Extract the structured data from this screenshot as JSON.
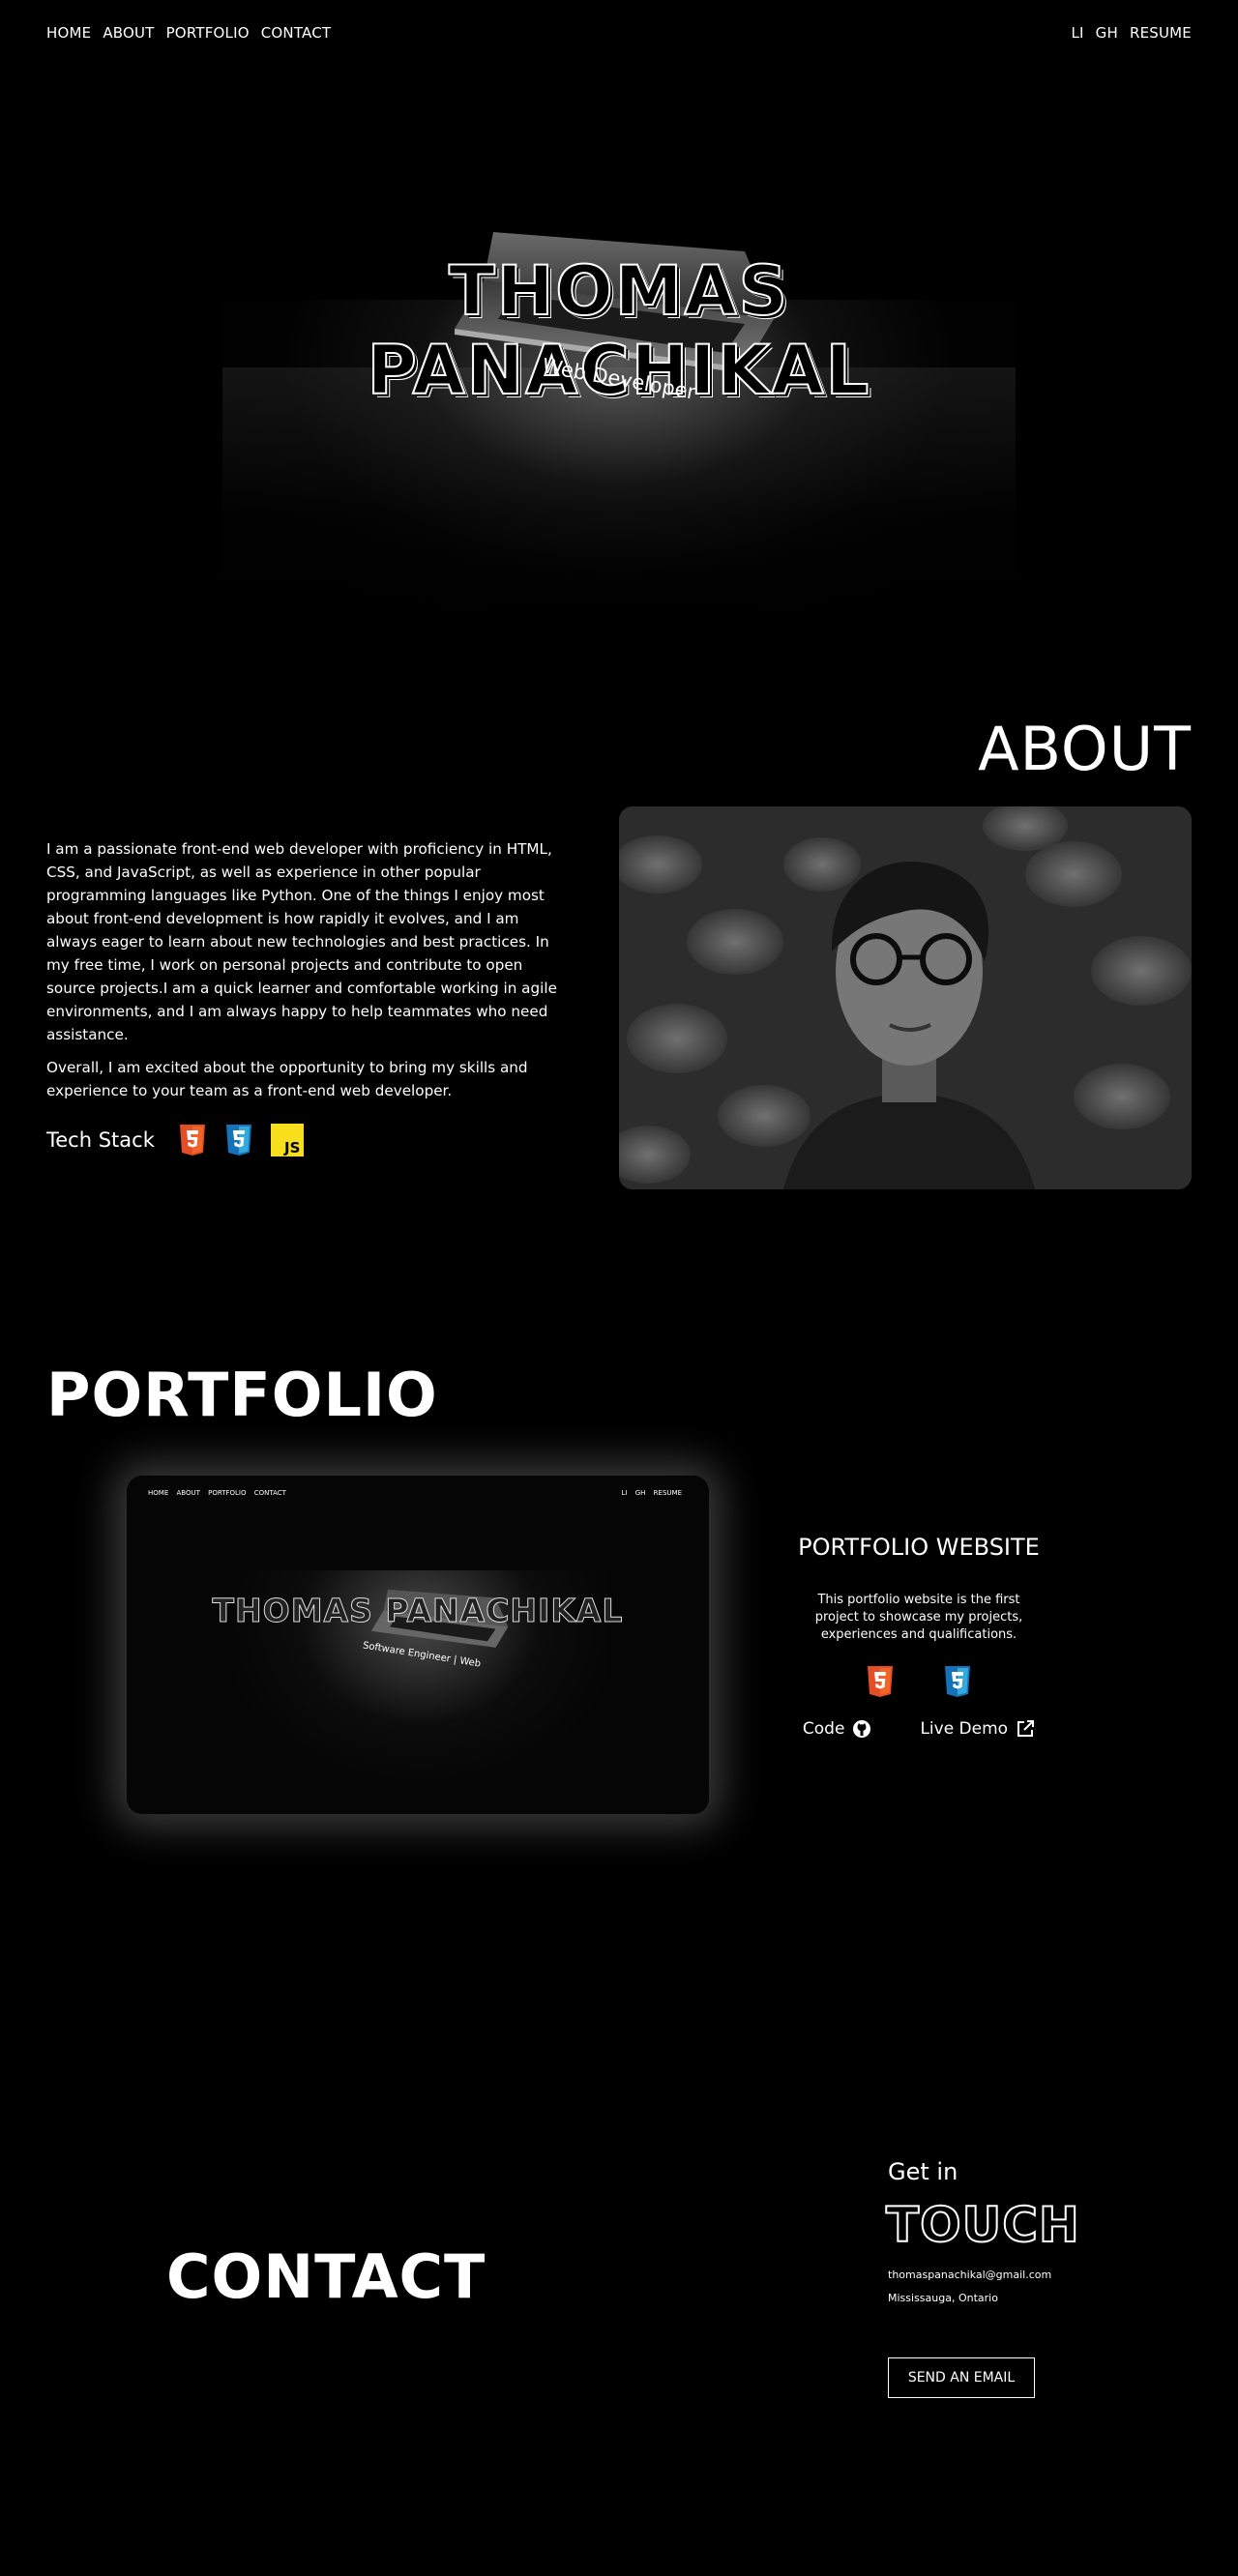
{
  "nav": {
    "left": [
      "HOME",
      "ABOUT",
      "PORTFOLIO",
      "CONTACT"
    ],
    "right": [
      "LI",
      "GH",
      "RESUME"
    ]
  },
  "hero": {
    "title": "THOMAS PANACHIKAL",
    "subtitle": "Web Developer"
  },
  "about": {
    "title": "ABOUT",
    "paragraph1": "I am a passionate front-end web developer with proficiency in HTML, CSS, and JavaScript, as well as experience in other popular programming languages like Python. One of the things I enjoy most about front-end development is how rapidly it evolves, and I am always eager to learn about new technologies and best practices. In my free time, I work on personal projects and contribute to open source projects.I am a quick learner and comfortable working in agile environments, and I am always happy to help teammates who need assistance.",
    "paragraph2": "Overall, I am excited about the opportunity to bring my skills and experience to your team as a front-end web developer.",
    "tech_label": "Tech Stack",
    "tech_icons": [
      "html5-icon",
      "css3-icon",
      "javascript-icon"
    ]
  },
  "portfolio": {
    "title": "PORTFOLIO",
    "screenshot": {
      "nav_left": [
        "HOME",
        "ABOUT",
        "PORTFOLIO",
        "CONTACT"
      ],
      "nav_right": [
        "LI",
        "GH",
        "RESUME"
      ],
      "title": "THOMAS PANACHIKAL",
      "subtitle": "Software Engineer | Web"
    },
    "project": {
      "name": "PORTFOLIO WEBSITE",
      "description": "This portfolio website is the first project to showcase my projects, experiences and qualifications.",
      "code_label": "Code",
      "demo_label": "Live Demo"
    }
  },
  "contact": {
    "title": "CONTACT",
    "getin": "Get in",
    "touch": "TOUCH",
    "email": "thomaspanachikal@gmail.com",
    "location": "Mississauga, Ontario",
    "button": "SEND AN EMAIL"
  },
  "colors": {
    "background": "#000000",
    "html5": "#E44D26",
    "css3": "#1572B6",
    "javascript": "#F7DF1E"
  }
}
